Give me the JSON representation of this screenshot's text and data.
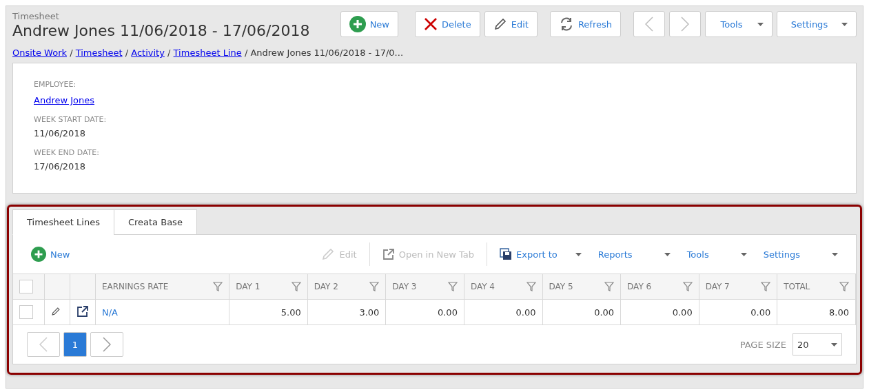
{
  "header": {
    "subtitle": "Timesheet",
    "title": "Andrew Jones 11/06/2018 - 17/06/2018"
  },
  "toolbar": [
    {
      "kind": "new",
      "label": "New"
    },
    {
      "kind": "delete",
      "label": "Delete"
    },
    {
      "kind": "edit",
      "label": "Edit"
    },
    {
      "kind": "refresh",
      "label": "Refresh"
    },
    {
      "kind": "prev"
    },
    {
      "kind": "next"
    },
    {
      "kind": "dropdown",
      "label": "Tools"
    },
    {
      "kind": "dropdown",
      "label": "Settings"
    }
  ],
  "breadcrumb": {
    "separator": "/",
    "links": [
      "Onsite Work",
      "Timesheet",
      "Activity",
      "Timesheet Line"
    ],
    "current": "Andrew Jones 11/06/2018 - 17/0..."
  },
  "fields": [
    {
      "label": "EMPLOYEE:",
      "value": "Andrew Jones",
      "kind": "link"
    },
    {
      "label": "WEEK START DATE:",
      "value": "11/06/2018",
      "kind": "text"
    },
    {
      "label": "WEEK END DATE:",
      "value": "17/06/2018",
      "kind": "text"
    }
  ],
  "tabs": [
    {
      "label": "Timesheet Lines",
      "selected": true
    },
    {
      "label": "Creata Base",
      "selected": false
    }
  ],
  "grid_toolbar": [
    {
      "kind": "new",
      "label": "New",
      "disabled": false
    },
    {
      "kind": "edit",
      "label": "Edit",
      "disabled": true
    },
    {
      "kind": "open",
      "label": "Open in New Tab",
      "disabled": true
    },
    {
      "kind": "export",
      "label": "Export to",
      "disabled": false
    },
    {
      "kind": "menu",
      "label": "Reports",
      "disabled": false
    },
    {
      "kind": "menu",
      "label": "Tools",
      "disabled": false
    },
    {
      "kind": "menu",
      "label": "Settings",
      "disabled": false
    }
  ],
  "table": {
    "columns": [
      "EARNINGS RATE",
      "DAY 1",
      "DAY 2",
      "DAY 3",
      "DAY 4",
      "DAY 5",
      "DAY 6",
      "DAY 7",
      "TOTAL"
    ],
    "all_checked": false,
    "rows": [
      {
        "checked": false,
        "cells": [
          "N/A",
          "5.00",
          "3.00",
          "0.00",
          "0.00",
          "0.00",
          "0.00",
          "0.00",
          "8.00"
        ]
      }
    ]
  },
  "pager": {
    "pages": [
      {
        "label": "1",
        "selected": true
      }
    ],
    "page_size_label": "PAGE SIZE",
    "page_size": "20"
  }
}
